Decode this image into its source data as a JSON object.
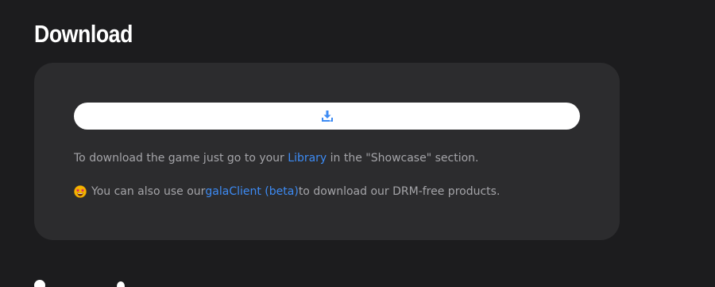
{
  "section": {
    "title": "Download"
  },
  "card": {
    "download_button": {
      "icon": "download-icon",
      "icon_color": "#3d8bf4"
    },
    "info1": {
      "prefix": "To download the game just go to your ",
      "link_text": "Library",
      "suffix": " in the \"Showcase\" section."
    },
    "info2": {
      "emoji": "star-struck-emoji",
      "prefix": "You can also use our ",
      "link_text": "galaClient (beta)",
      "suffix": " to download our DRM-free products."
    }
  },
  "colors": {
    "background": "#1c1c1e",
    "card": "#2c2c2e",
    "link": "#3d8bf4",
    "text_muted": "#a4a4a8"
  }
}
